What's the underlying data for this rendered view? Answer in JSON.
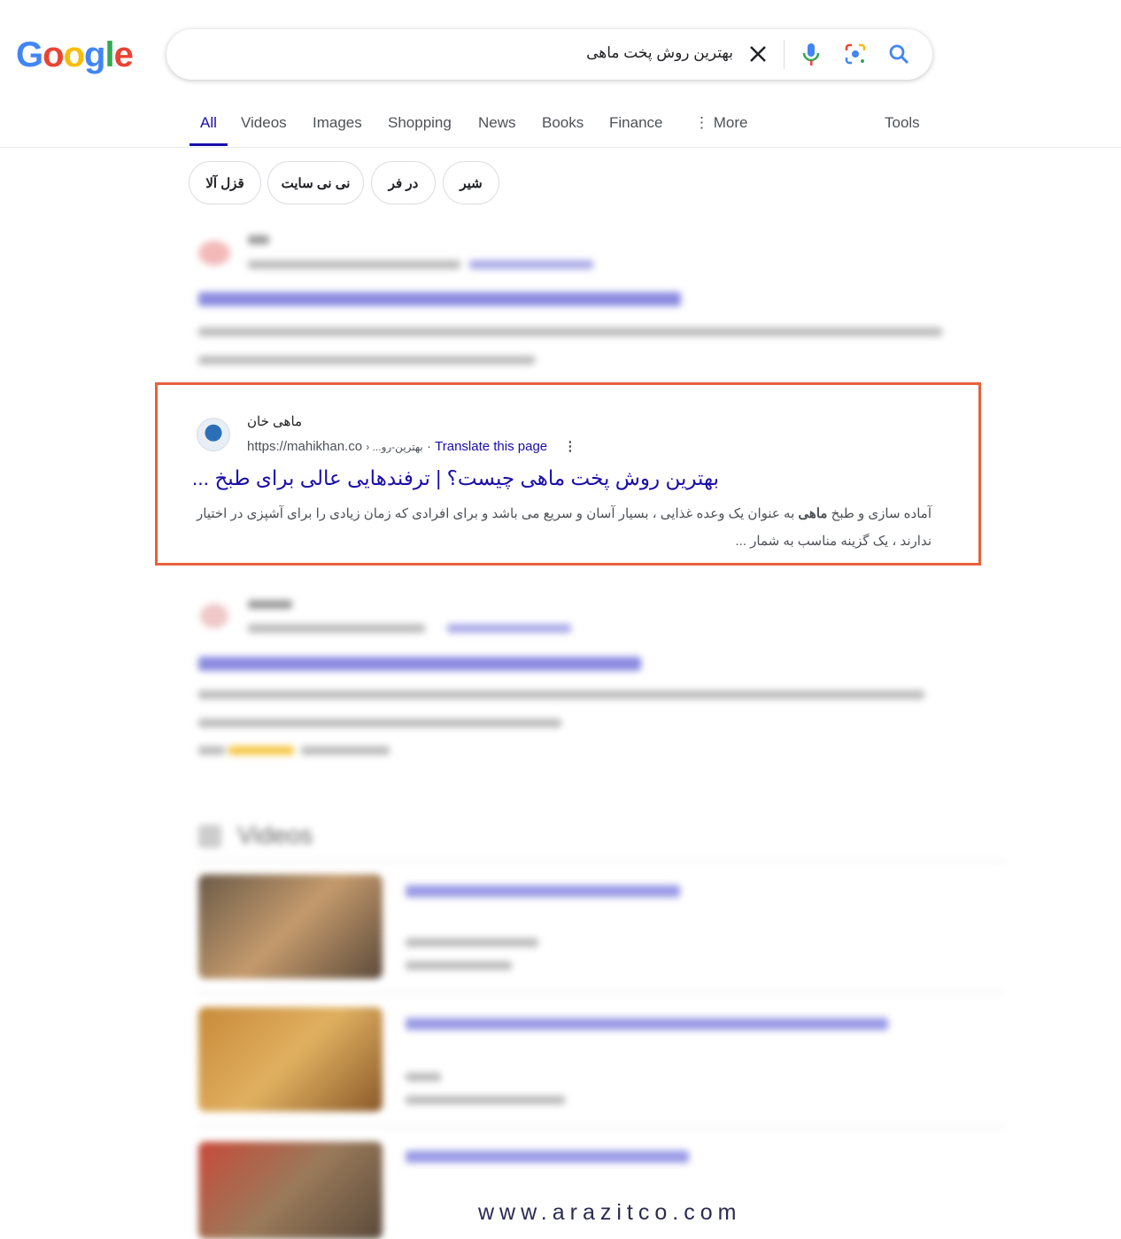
{
  "logo": "Google",
  "search": {
    "query": "بهترین روش پخت ماهی",
    "icons": [
      "close-icon",
      "mic-icon",
      "lens-icon",
      "search-icon"
    ]
  },
  "tabs": [
    {
      "label": "All",
      "active": true
    },
    {
      "label": "Videos"
    },
    {
      "label": "Images"
    },
    {
      "label": "Shopping"
    },
    {
      "label": "News"
    },
    {
      "label": "Books"
    },
    {
      "label": "Finance"
    },
    {
      "label": "More"
    }
  ],
  "tools": "Tools",
  "chips": [
    "قزل آلا",
    "نی نی سایت",
    "در فر",
    "شیر"
  ],
  "highlighted_result": {
    "site_name": "ماهی خان",
    "url": "https://mahikhan.co",
    "path": "› ...بهترین-رو",
    "translate": "Translate this page",
    "title": "بهترین روش پخت ماهی چیست؟ | ترفندهایی عالی برای طبخ ...",
    "snippet_before": "آماده سازی و طبخ ",
    "snippet_bold": "ماهی",
    "snippet_after": " به عنوان یک وعده غذایی ، بسیار آسان و سریع می باشد و برای افرادی که زمان زیادی را برای آشپزی در اختیار ندارند ، یک گزینه مناسب به شمار ..."
  },
  "videos_heading": "Videos",
  "highlight_color": "#e8603c",
  "link_color": "#1a0dab",
  "watermark": "www.arazitco.com"
}
